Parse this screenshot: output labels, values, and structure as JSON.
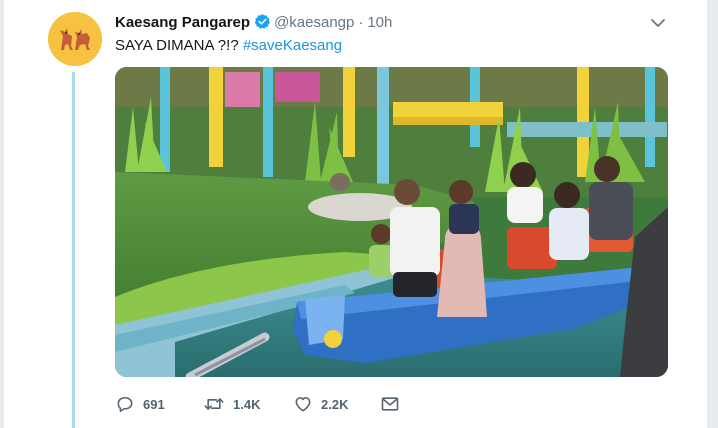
{
  "tweet": {
    "author_name": "Kaesang Pangarep",
    "handle": "@kaesangp",
    "time": "10h",
    "text": "SAYA DIMANA ?!? ",
    "hashtag": "#saveKaesang"
  },
  "actions": {
    "replies": "691",
    "retweets": "1.4K",
    "likes": "2.2K"
  },
  "icons": [
    "verified-badge-icon",
    "chevron-down-icon",
    "reply-icon",
    "retweet-icon",
    "like-icon",
    "message-icon"
  ],
  "colors": {
    "link": "#1b95e0",
    "verified": "#1da1f2",
    "thread_line": "#a9dbe8",
    "avatar_bg": "#f6c240"
  }
}
